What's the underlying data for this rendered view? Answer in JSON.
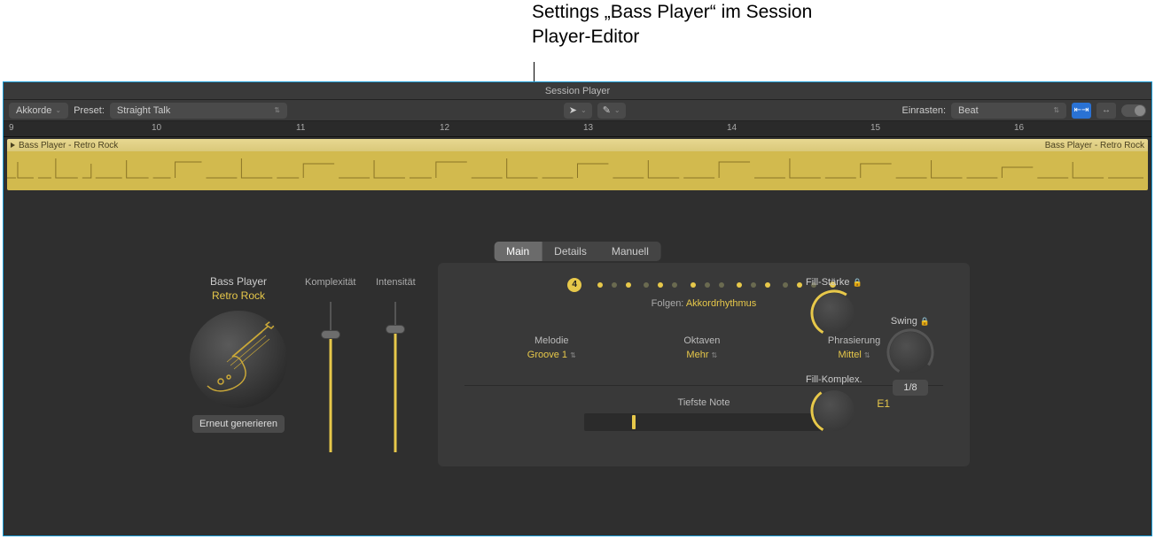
{
  "callout": "Settings „Bass Player“ im Session Player-Editor",
  "titlebar": "Session Player",
  "toolbar": {
    "chords_btn": "Akkorde",
    "preset_label": "Preset:",
    "preset_value": "Straight Talk",
    "snap_label": "Einrasten:",
    "snap_value": "Beat"
  },
  "ruler": {
    "marks": [
      "9",
      "10",
      "11",
      "12",
      "13",
      "14",
      "15",
      "16"
    ]
  },
  "region": {
    "name1": "Bass Player - Retro Rock",
    "name2": "Bass Player - Retro Rock"
  },
  "tabs": {
    "main": "Main",
    "details": "Details",
    "manual": "Manuell"
  },
  "player": {
    "title": "Bass Player",
    "style": "Retro Rock",
    "regen": "Erneut generieren"
  },
  "sliders": {
    "complexity": {
      "label": "Komplexität",
      "value": 0.78
    },
    "intensity": {
      "label": "Intensität",
      "value": 0.82
    }
  },
  "panel": {
    "beat_number": "4",
    "follow_label": "Folgen:",
    "follow_value": "Akkordrhythmus",
    "params": {
      "melody": {
        "label": "Melodie",
        "value": "Groove 1"
      },
      "octaves": {
        "label": "Oktaven",
        "value": "Mehr"
      },
      "phrasing": {
        "label": "Phrasierung",
        "value": "Mittel"
      }
    },
    "lowest_note_label": "Tiefste Note",
    "lowest_note_value": "E1"
  },
  "knobs": {
    "fill_strength": "Fill-Stärke",
    "fill_complex": "Fill-Komplex.",
    "swing": "Swing",
    "swing_division": "1/8"
  },
  "colors": {
    "accent": "#e7c84a",
    "panel": "#393939",
    "bg": "#2f2f2f"
  }
}
